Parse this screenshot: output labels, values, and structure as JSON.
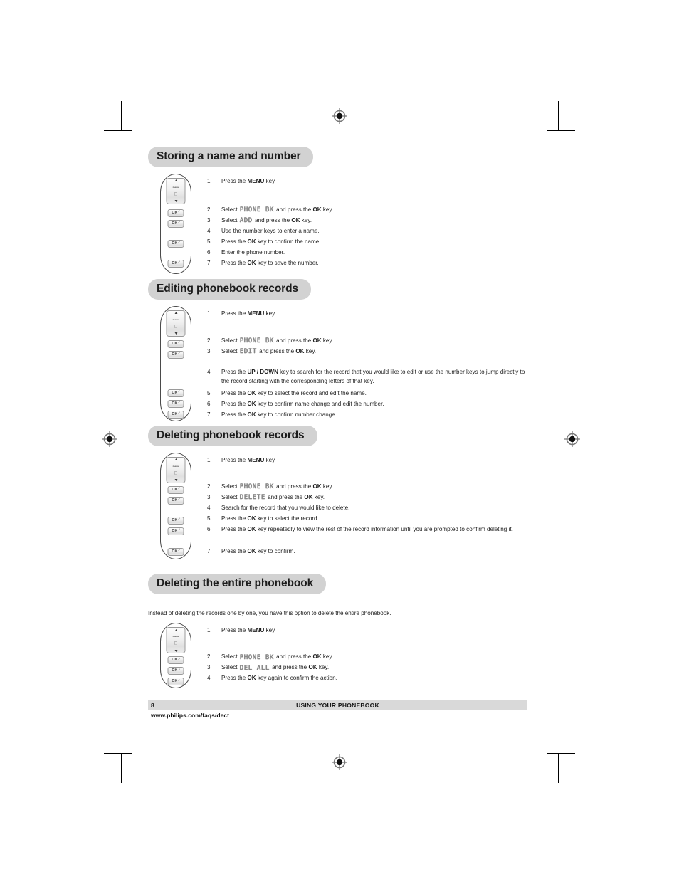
{
  "document": {
    "page_number": "8",
    "footer_title": "USING YOUR PHONEBOOK",
    "footer_url": "www.philips.com/faqs/dect",
    "accent_gray": "#d2d2d2",
    "footer_gray": "#d9d9d9"
  },
  "keys": {
    "menu_label": "menu",
    "ok_label": "OK",
    "nav_mid_icon": "nav-icon",
    "ok_arrow_icon": "arrow-up-right-icon"
  },
  "sections": [
    {
      "id": "storing",
      "heading": "Storing a name and number",
      "intro": "",
      "steps": [
        {
          "num": "1.",
          "pre": "Press the ",
          "bold": "MENU",
          "post": " key.",
          "lcd": ""
        },
        {
          "num": "2.",
          "pre": "Select ",
          "lcd": "PHONE BK",
          "mid": " and press the ",
          "bold": "OK",
          "post": " key."
        },
        {
          "num": "3.",
          "pre": "Select ",
          "lcd": "ADD",
          "mid": " and press the ",
          "bold": "OK",
          "post": " key."
        },
        {
          "num": "4.",
          "pre": "Use the number keys to enter a name.",
          "bold": "",
          "post": "",
          "lcd": ""
        },
        {
          "num": "5.",
          "pre": "Press the ",
          "bold": "OK",
          "post": " key to confirm the name.",
          "lcd": ""
        },
        {
          "num": "6.",
          "pre": " Enter the phone number.",
          "bold": "",
          "post": "",
          "lcd": ""
        },
        {
          "num": "7.",
          "pre": "Press the ",
          "bold": "OK",
          "post": " key to save the number.",
          "lcd": ""
        }
      ]
    },
    {
      "id": "editing",
      "heading": "Editing phonebook records",
      "intro": "",
      "steps": [
        {
          "num": "1.",
          "pre": "Press the ",
          "bold": "MENU",
          "post": " key.",
          "lcd": ""
        },
        {
          "num": "2.",
          "pre": "Select ",
          "lcd": "PHONE BK",
          "mid": " and press the ",
          "bold": "OK",
          "post": " key."
        },
        {
          "num": "3.",
          "pre": "Select ",
          "lcd": "EDIT",
          "mid": " and press the ",
          "bold": "OK",
          "post": " key."
        },
        {
          "num": "4.",
          "pre": "Press the ",
          "bold": "UP / DOWN",
          "post": " key to search for the record that you would like to edit or use the number keys to jump directly to the record starting with the corresponding letters of that key.",
          "lcd": ""
        },
        {
          "num": "5.",
          "pre": "Press the ",
          "bold": "OK",
          "post": " key to select the record and edit the name.",
          "lcd": ""
        },
        {
          "num": "6.",
          "pre": "Press the ",
          "bold": "OK",
          "post": " key to confirm name change and edit the number.",
          "lcd": ""
        },
        {
          "num": "7.",
          "pre": "Press the ",
          "bold": "OK",
          "post": " key to confirm number change.",
          "lcd": ""
        }
      ]
    },
    {
      "id": "deleting-records",
      "heading": "Deleting phonebook records",
      "intro": "",
      "steps": [
        {
          "num": "1.",
          "pre": "Press the ",
          "bold": "MENU",
          "post": " key.",
          "lcd": ""
        },
        {
          "num": "2.",
          "pre": "Select ",
          "lcd": "PHONE BK",
          "mid": " and press the ",
          "bold": "OK",
          "post": " key."
        },
        {
          "num": "3.",
          "pre": "Select ",
          "lcd": "DELETE",
          "mid": " and press the ",
          "bold": "OK",
          "post": " key."
        },
        {
          "num": "4.",
          "pre": "Search for the record that you would like to delete.",
          "bold": "",
          "post": "",
          "lcd": ""
        },
        {
          "num": "5.",
          "pre": "Press the ",
          "bold": "OK",
          "post": " key to select the record.",
          "lcd": ""
        },
        {
          "num": "6.",
          "pre": "Press the ",
          "bold": "OK",
          "post": " key repeatedly to view the rest of the record information until you are prompted to confirm deleting it.",
          "lcd": ""
        },
        {
          "num": "7.",
          "pre": "Press the ",
          "bold": "OK",
          "post": " key to confirm.",
          "lcd": ""
        }
      ]
    },
    {
      "id": "deleting-all",
      "heading": "Deleting the entire phonebook",
      "intro": "Instead of deleting the records one by one, you have this option to delete the entire phonebook.",
      "steps": [
        {
          "num": "1.",
          "pre": "Press the ",
          "bold": "MENU",
          "post": " key.",
          "lcd": ""
        },
        {
          "num": "2.",
          "pre": "Select ",
          "lcd": "PHONE BK",
          "mid": " and press the ",
          "bold": "OK",
          "post": " key."
        },
        {
          "num": "3.",
          "pre": "Select ",
          "lcd": "DEL ALL",
          "mid": " and press the ",
          "bold": "OK",
          "post": " key."
        },
        {
          "num": "4.",
          "pre": "Press the ",
          "bold": "OK",
          "post": " key again to confirm the action.",
          "lcd": ""
        }
      ]
    }
  ]
}
